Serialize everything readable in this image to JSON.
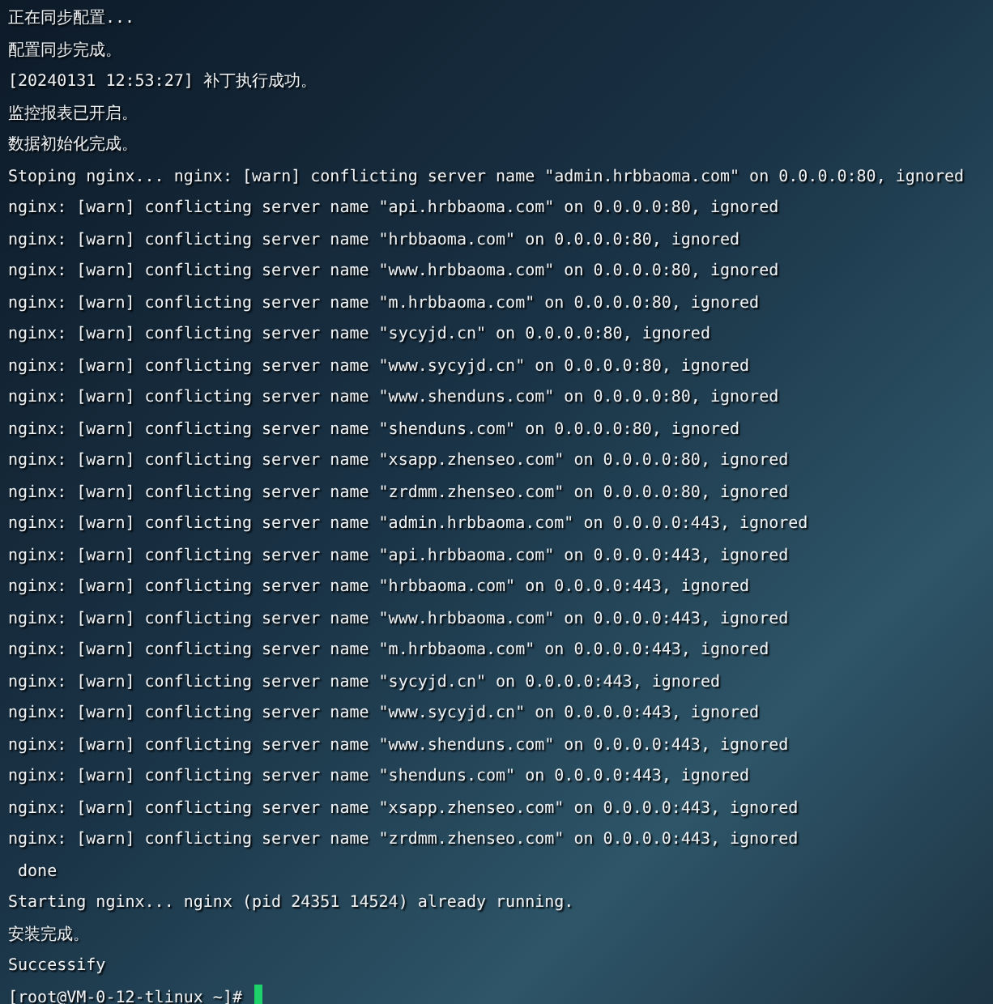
{
  "lines": [
    "正在同步配置...",
    "配置同步完成。",
    "[20240131 12:53:27] 补丁执行成功。",
    "监控报表已开启。",
    "数据初始化完成。",
    "Stoping nginx... nginx: [warn] conflicting server name \"admin.hrbbaoma.com\" on 0.0.0.0:80, ignored",
    "nginx: [warn] conflicting server name \"api.hrbbaoma.com\" on 0.0.0.0:80, ignored",
    "nginx: [warn] conflicting server name \"hrbbaoma.com\" on 0.0.0.0:80, ignored",
    "nginx: [warn] conflicting server name \"www.hrbbaoma.com\" on 0.0.0.0:80, ignored",
    "nginx: [warn] conflicting server name \"m.hrbbaoma.com\" on 0.0.0.0:80, ignored",
    "nginx: [warn] conflicting server name \"sycyjd.cn\" on 0.0.0.0:80, ignored",
    "nginx: [warn] conflicting server name \"www.sycyjd.cn\" on 0.0.0.0:80, ignored",
    "nginx: [warn] conflicting server name \"www.shenduns.com\" on 0.0.0.0:80, ignored",
    "nginx: [warn] conflicting server name \"shenduns.com\" on 0.0.0.0:80, ignored",
    "nginx: [warn] conflicting server name \"xsapp.zhenseo.com\" on 0.0.0.0:80, ignored",
    "nginx: [warn] conflicting server name \"zrdmm.zhenseo.com\" on 0.0.0.0:80, ignored",
    "nginx: [warn] conflicting server name \"admin.hrbbaoma.com\" on 0.0.0.0:443, ignored",
    "nginx: [warn] conflicting server name \"api.hrbbaoma.com\" on 0.0.0.0:443, ignored",
    "nginx: [warn] conflicting server name \"hrbbaoma.com\" on 0.0.0.0:443, ignored",
    "nginx: [warn] conflicting server name \"www.hrbbaoma.com\" on 0.0.0.0:443, ignored",
    "nginx: [warn] conflicting server name \"m.hrbbaoma.com\" on 0.0.0.0:443, ignored",
    "nginx: [warn] conflicting server name \"sycyjd.cn\" on 0.0.0.0:443, ignored",
    "nginx: [warn] conflicting server name \"www.sycyjd.cn\" on 0.0.0.0:443, ignored",
    "nginx: [warn] conflicting server name \"www.shenduns.com\" on 0.0.0.0:443, ignored",
    "nginx: [warn] conflicting server name \"shenduns.com\" on 0.0.0.0:443, ignored",
    "nginx: [warn] conflicting server name \"xsapp.zhenseo.com\" on 0.0.0.0:443, ignored",
    "nginx: [warn] conflicting server name \"zrdmm.zhenseo.com\" on 0.0.0.0:443, ignored",
    " done",
    "Starting nginx... nginx (pid 24351 14524) already running.",
    "安装完成。",
    "Successify"
  ],
  "prompt": "[root@VM-0-12-tlinux ~]#"
}
